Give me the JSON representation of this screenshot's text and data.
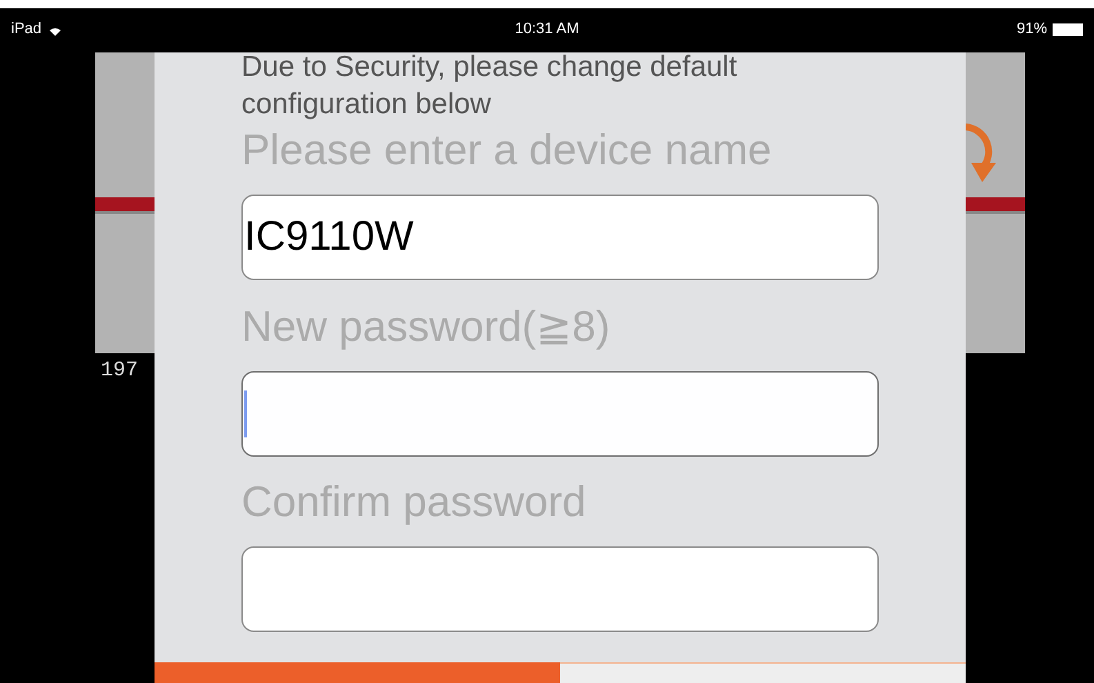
{
  "status_bar": {
    "device": "iPad",
    "time": "10:31 AM",
    "battery": "91%"
  },
  "background": {
    "caption": "197"
  },
  "dialog": {
    "message": "Due to Security, please change default configuration below",
    "fields": [
      {
        "label": "Please enter a device name",
        "value": "IC9110W",
        "focused": false
      },
      {
        "label": "New password(≧8)",
        "focused": true
      },
      {
        "label": "Confirm password",
        "focused": false
      }
    ],
    "buttons": [
      {
        "kind": "primary"
      },
      {
        "kind": "secondary"
      }
    ]
  }
}
